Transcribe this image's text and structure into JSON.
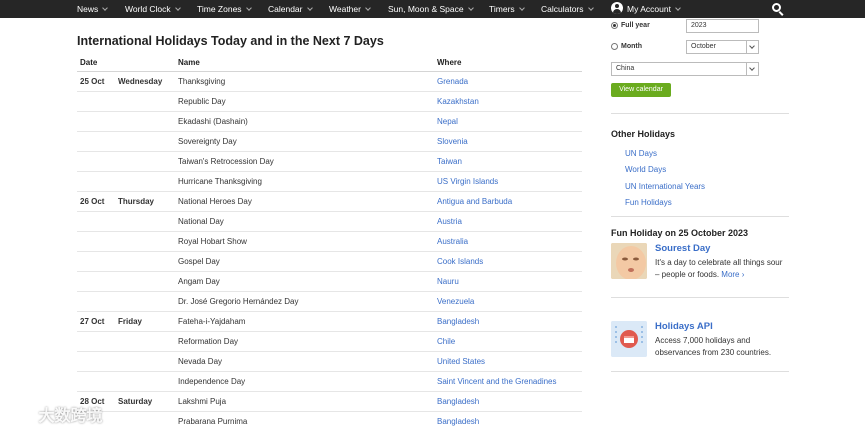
{
  "nav": {
    "items": [
      {
        "label": "News",
        "chevron": true
      },
      {
        "label": "World Clock",
        "chevron": true
      },
      {
        "label": "Time Zones",
        "chevron": true
      },
      {
        "label": "Calendar",
        "chevron": true
      },
      {
        "label": "Weather",
        "chevron": true
      },
      {
        "label": "Sun, Moon & Space",
        "chevron": true
      },
      {
        "label": "Timers",
        "chevron": true
      },
      {
        "label": "Calculators",
        "chevron": true
      }
    ],
    "account_label": "My Account",
    "account_icon": "user-icon",
    "search_icon": "search-icon"
  },
  "main": {
    "title": "International Holidays Today and in the Next 7 Days",
    "columns": {
      "date": "Date",
      "name": "Name",
      "where": "Where"
    },
    "rows": [
      {
        "date": "25 Oct",
        "dow": "Wednesday",
        "name": "Thanksgiving",
        "where": "Grenada"
      },
      {
        "date": "",
        "dow": "",
        "name": "Republic Day",
        "where": "Kazakhstan"
      },
      {
        "date": "",
        "dow": "",
        "name": "Ekadashi (Dashain)",
        "where": "Nepal"
      },
      {
        "date": "",
        "dow": "",
        "name": "Sovereignty Day",
        "where": "Slovenia"
      },
      {
        "date": "",
        "dow": "",
        "name": "Taiwan's Retrocession Day",
        "where": "Taiwan"
      },
      {
        "date": "",
        "dow": "",
        "name": "Hurricane Thanksgiving",
        "where": "US Virgin Islands"
      },
      {
        "date": "26 Oct",
        "dow": "Thursday",
        "name": "National Heroes Day",
        "where": "Antigua and Barbuda"
      },
      {
        "date": "",
        "dow": "",
        "name": "National Day",
        "where": "Austria"
      },
      {
        "date": "",
        "dow": "",
        "name": "Royal Hobart Show",
        "where": "Australia"
      },
      {
        "date": "",
        "dow": "",
        "name": "Gospel Day",
        "where": "Cook Islands"
      },
      {
        "date": "",
        "dow": "",
        "name": "Angam Day",
        "where": "Nauru"
      },
      {
        "date": "",
        "dow": "",
        "name": "Dr. José Gregorio Hernández Day",
        "where": "Venezuela"
      },
      {
        "date": "27 Oct",
        "dow": "Friday",
        "name": "Fateha-i-Yajdaham",
        "where": "Bangladesh"
      },
      {
        "date": "",
        "dow": "",
        "name": "Reformation Day",
        "where": "Chile"
      },
      {
        "date": "",
        "dow": "",
        "name": "Nevada Day",
        "where": "United States"
      },
      {
        "date": "",
        "dow": "",
        "name": "Independence Day",
        "where": "Saint Vincent and the Grenadines"
      },
      {
        "date": "28 Oct",
        "dow": "Saturday",
        "name": "Lakshmi Puja",
        "where": "Bangladesh"
      },
      {
        "date": "",
        "dow": "",
        "name": "Prabarana Purnima",
        "where": "Bangladesh"
      }
    ]
  },
  "sidebar": {
    "form": {
      "full_year_label": "Full year",
      "full_year_selected": true,
      "year_value": "2023",
      "month_label": "Month",
      "month_selected": false,
      "month_value": "October",
      "country_value": "China",
      "button_label": "View calendar"
    },
    "other_holidays": {
      "title": "Other Holidays",
      "links": [
        "UN Days",
        "World Days",
        "UN International Years",
        "Fun Holidays"
      ]
    },
    "fun_holiday": {
      "title": "Fun Holiday on 25 October 2023",
      "name": "Sourest Day",
      "text_line1": "It's a day to celebrate all things sour",
      "text_line2": "– people or foods.",
      "more_label": "More"
    },
    "api": {
      "title": "Holidays API",
      "text_line1": "Access 7,000 holidays and",
      "text_line2": "observances from 230 countries."
    }
  },
  "watermark": {
    "text": "大数跨境"
  },
  "colors": {
    "nav_bg": "#262626",
    "link": "#3a6ec8",
    "button": "#6aab1e"
  }
}
